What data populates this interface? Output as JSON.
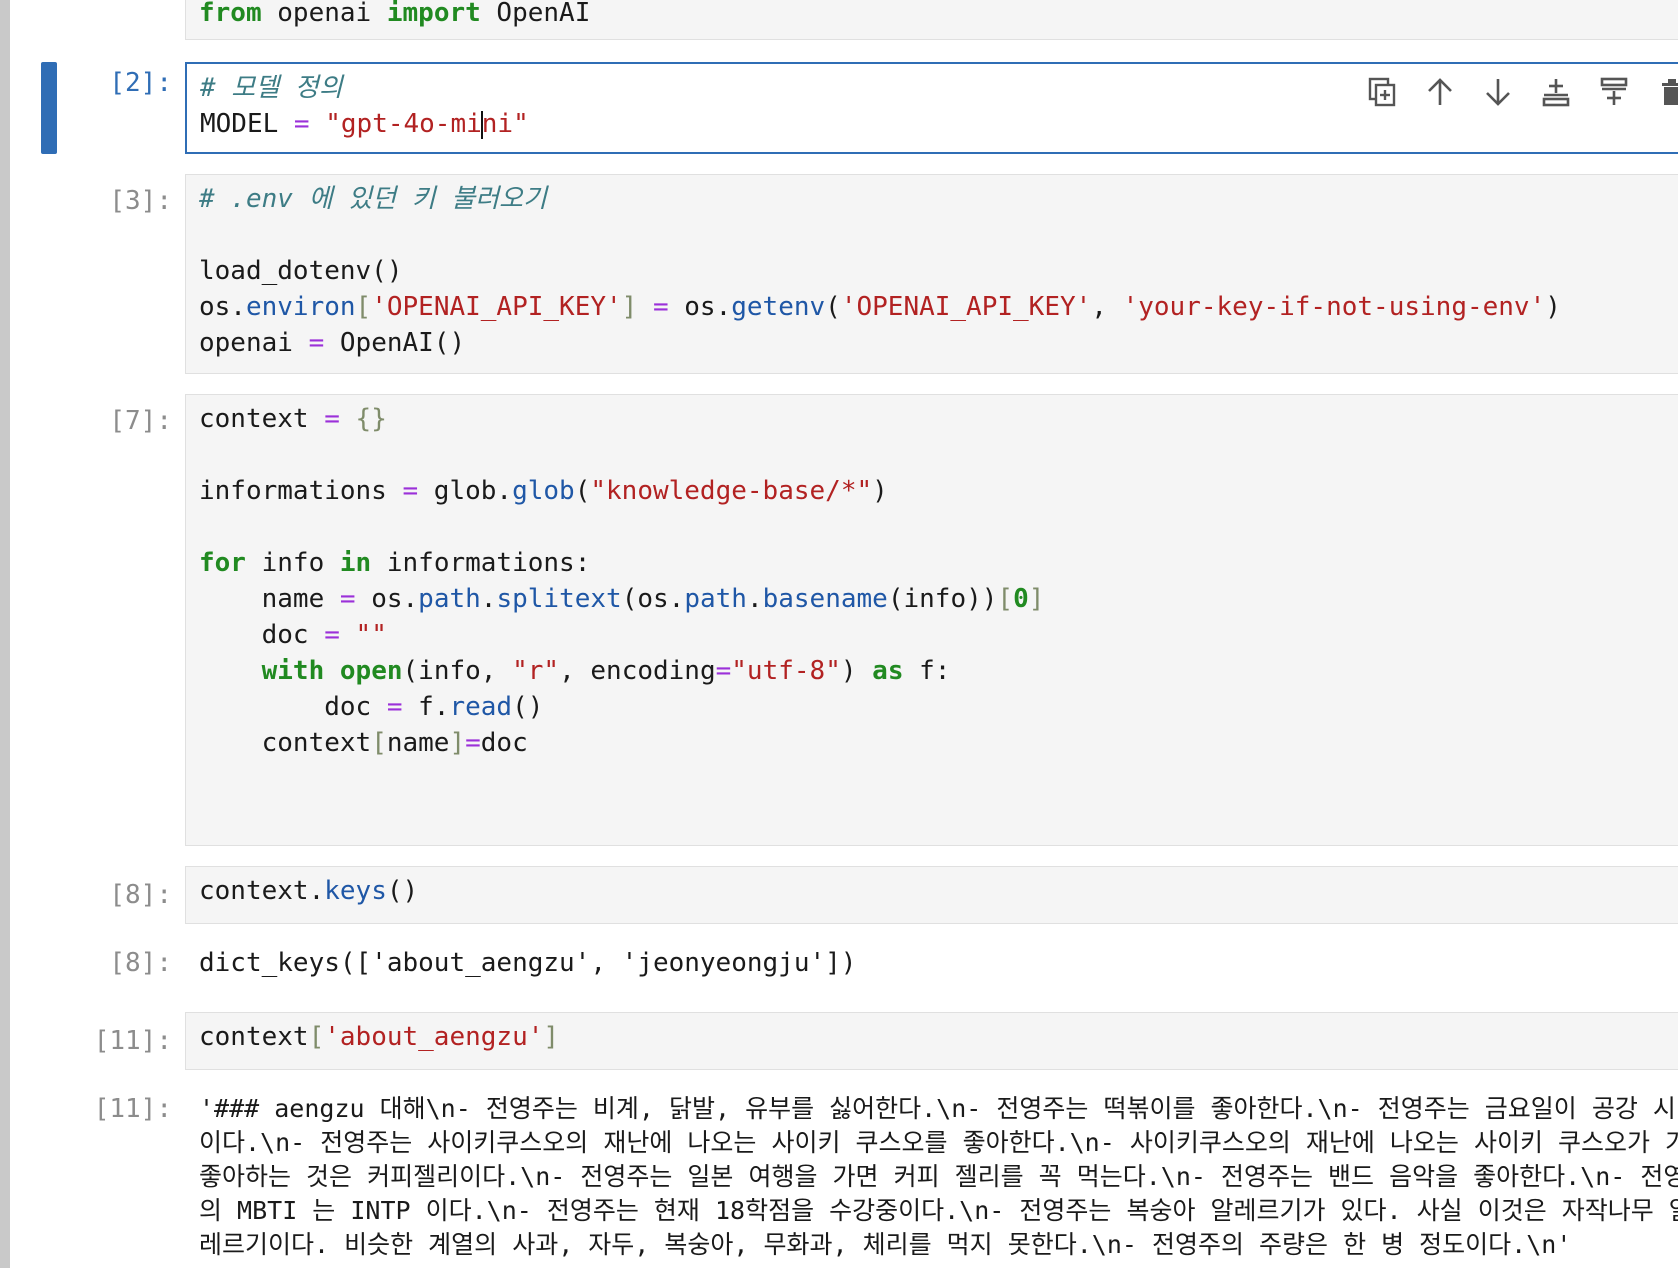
{
  "notebook": {
    "cells": [
      {
        "id": "import",
        "prompt": "",
        "code_lines": [
          [
            {
              "t": "from",
              "c": "kw"
            },
            {
              "t": " openai "
            },
            {
              "t": "import",
              "c": "kw"
            },
            {
              "t": " OpenAI"
            }
          ]
        ]
      },
      {
        "id": "model",
        "prompt": "[2]:",
        "active": true,
        "code_lines": [
          [
            {
              "t": "# 모델 정의",
              "c": "cm"
            }
          ],
          [
            {
              "t": "MODEL "
            },
            {
              "t": "=",
              "c": "op"
            },
            {
              "t": " "
            },
            {
              "t": "\"gpt-4o-mi",
              "c": "str"
            },
            {
              "caret": true
            },
            {
              "t": "ni\"",
              "c": "str"
            }
          ]
        ]
      },
      {
        "id": "env",
        "prompt": "[3]:",
        "code_lines": [
          [
            {
              "t": "# .env 에 있던 키 불러오기",
              "c": "cm"
            }
          ],
          [],
          [
            {
              "t": "load_dotenv()"
            }
          ],
          [
            {
              "t": "os."
            },
            {
              "t": "environ",
              "c": "fn"
            },
            {
              "t": "[",
              "c": "br"
            },
            {
              "t": "'OPENAI_API_KEY'",
              "c": "str"
            },
            {
              "t": "]",
              "c": "br"
            },
            {
              "t": " "
            },
            {
              "t": "=",
              "c": "op"
            },
            {
              "t": " os."
            },
            {
              "t": "getenv",
              "c": "fn"
            },
            {
              "t": "("
            },
            {
              "t": "'OPENAI_API_KEY'",
              "c": "str"
            },
            {
              "t": ", "
            },
            {
              "t": "'your-key-if-not-using-env'",
              "c": "str"
            },
            {
              "t": ")"
            }
          ],
          [
            {
              "t": "openai "
            },
            {
              "t": "=",
              "c": "op"
            },
            {
              "t": " OpenAI()"
            }
          ]
        ]
      },
      {
        "id": "context",
        "prompt": "[7]:",
        "code_lines": [
          [
            {
              "t": "context "
            },
            {
              "t": "=",
              "c": "op"
            },
            {
              "t": " "
            },
            {
              "t": "{}",
              "c": "br"
            }
          ],
          [],
          [
            {
              "t": "informations "
            },
            {
              "t": "=",
              "c": "op"
            },
            {
              "t": " glob."
            },
            {
              "t": "glob",
              "c": "fn"
            },
            {
              "t": "("
            },
            {
              "t": "\"knowledge-base/*\"",
              "c": "str"
            },
            {
              "t": ")"
            }
          ],
          [],
          [
            {
              "t": "for",
              "c": "kw"
            },
            {
              "t": " info "
            },
            {
              "t": "in",
              "c": "kw"
            },
            {
              "t": " informations:"
            }
          ],
          [
            {
              "t": "    name "
            },
            {
              "t": "=",
              "c": "op"
            },
            {
              "t": " os."
            },
            {
              "t": "path",
              "c": "fn"
            },
            {
              "t": "."
            },
            {
              "t": "splitext",
              "c": "fn"
            },
            {
              "t": "(os."
            },
            {
              "t": "path",
              "c": "fn"
            },
            {
              "t": "."
            },
            {
              "t": "basename",
              "c": "fn"
            },
            {
              "t": "(info))"
            },
            {
              "t": "[",
              "c": "br"
            },
            {
              "t": "0",
              "c": "kw"
            },
            {
              "t": "]",
              "c": "br"
            }
          ],
          [
            {
              "t": "    doc "
            },
            {
              "t": "=",
              "c": "op"
            },
            {
              "t": " "
            },
            {
              "t": "\"\"",
              "c": "str"
            }
          ],
          [
            {
              "t": "    "
            },
            {
              "t": "with",
              "c": "kw"
            },
            {
              "t": " "
            },
            {
              "t": "open",
              "c": "kw"
            },
            {
              "t": "(info, "
            },
            {
              "t": "\"r\"",
              "c": "str"
            },
            {
              "t": ", encoding"
            },
            {
              "t": "=",
              "c": "op"
            },
            {
              "t": "\"utf-8\"",
              "c": "str"
            },
            {
              "t": ") "
            },
            {
              "t": "as",
              "c": "kw"
            },
            {
              "t": " f:"
            }
          ],
          [
            {
              "t": "        doc "
            },
            {
              "t": "=",
              "c": "op"
            },
            {
              "t": " f."
            },
            {
              "t": "read",
              "c": "fn"
            },
            {
              "t": "()"
            }
          ],
          [
            {
              "t": "    context"
            },
            {
              "t": "[",
              "c": "br"
            },
            {
              "t": "name"
            },
            {
              "t": "]",
              "c": "br"
            },
            {
              "t": "=",
              "c": "op"
            },
            {
              "t": "doc"
            }
          ],
          [],
          []
        ]
      },
      {
        "id": "keys",
        "prompt": "[8]:",
        "code_lines": [
          [
            {
              "t": "context."
            },
            {
              "t": "keys",
              "c": "fn"
            },
            {
              "t": "()"
            }
          ]
        ]
      },
      {
        "id": "keys-out",
        "prompt": "[8]:",
        "output_lines": [
          "dict_keys(['about_aengzu', 'jeonyeongju'])"
        ]
      },
      {
        "id": "about",
        "prompt": "[11]:",
        "code_lines": [
          [
            {
              "t": "context"
            },
            {
              "t": "[",
              "c": "br"
            },
            {
              "t": "'about_aengzu'",
              "c": "str"
            },
            {
              "t": "]",
              "c": "br"
            }
          ]
        ]
      },
      {
        "id": "about-out",
        "prompt": "[11]:",
        "output_lines": [
          "'### aengzu 대해\\n- 전영주는 비계, 닭발, 유부를 싫어한다.\\n- 전영주는 떡볶이를 좋아한다.\\n- 전영주는 금요일이 공강 시",
          "이다.\\n- 전영주는 사이키쿠스오의 재난에 나오는 사이키 쿠스오를 좋아한다.\\n- 사이키쿠스오의 재난에 나오는 사이키 쿠스오가 가",
          "좋아하는 것은 커피젤리이다.\\n- 전영주는 일본 여행을 가면 커피 젤리를 꼭 먹는다.\\n- 전영주는 밴드 음악을 좋아한다.\\n- 전영",
          "의 MBTI 는 INTP 이다.\\n- 전영주는 현재 18학점을 수강중이다.\\n- 전영주는 복숭아 알레르기가 있다. 사실 이것은 자작나무 알",
          "레르기이다. 비슷한 계열의 사과, 자두, 복숭아, 무화과, 체리를 먹지 못한다.\\n- 전영주의 주량은 한 병 정도이다.\\n'"
        ]
      }
    ]
  },
  "toolbar": {
    "icons": [
      "duplicate-icon",
      "move-up-icon",
      "move-down-icon",
      "insert-above-icon",
      "insert-below-icon",
      "delete-icon"
    ]
  }
}
